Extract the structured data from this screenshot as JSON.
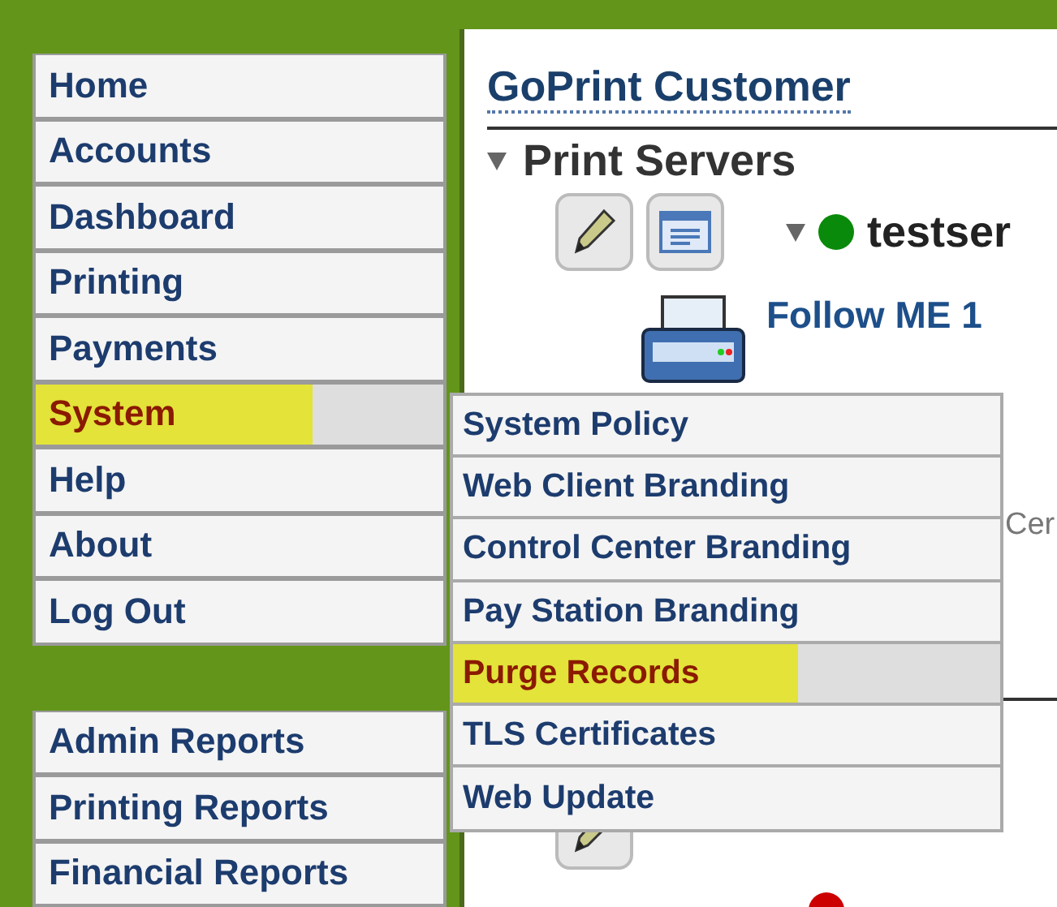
{
  "nav_menu": [
    {
      "label": "Home",
      "selected": false
    },
    {
      "label": "Accounts",
      "selected": false
    },
    {
      "label": "Dashboard",
      "selected": false
    },
    {
      "label": "Printing",
      "selected": false
    },
    {
      "label": "Payments",
      "selected": false
    },
    {
      "label": "System",
      "selected": true
    },
    {
      "label": "Help",
      "selected": false
    },
    {
      "label": "About",
      "selected": false
    },
    {
      "label": "Log Out",
      "selected": false
    }
  ],
  "reports_menu": [
    {
      "label": "Admin Reports",
      "selected": false
    },
    {
      "label": "Printing Reports",
      "selected": false
    },
    {
      "label": "Financial Reports",
      "selected": false
    }
  ],
  "submenu": [
    {
      "label": "System Policy",
      "selected": false
    },
    {
      "label": "Web Client Branding",
      "selected": false
    },
    {
      "label": "Control Center Branding",
      "selected": false
    },
    {
      "label": "Pay Station Branding",
      "selected": false
    },
    {
      "label": "Purge Records",
      "selected": true
    },
    {
      "label": "TLS Certificates",
      "selected": false
    },
    {
      "label": "Web Update",
      "selected": false
    }
  ],
  "content": {
    "title": "GoPrint Customer",
    "section": "Print Servers",
    "servers": [
      {
        "name": "testser",
        "color": "#0a8a0a",
        "printer": "Follow ME 1",
        "fragment": "Cer"
      },
      {
        "color": "#cc0000"
      }
    ]
  }
}
